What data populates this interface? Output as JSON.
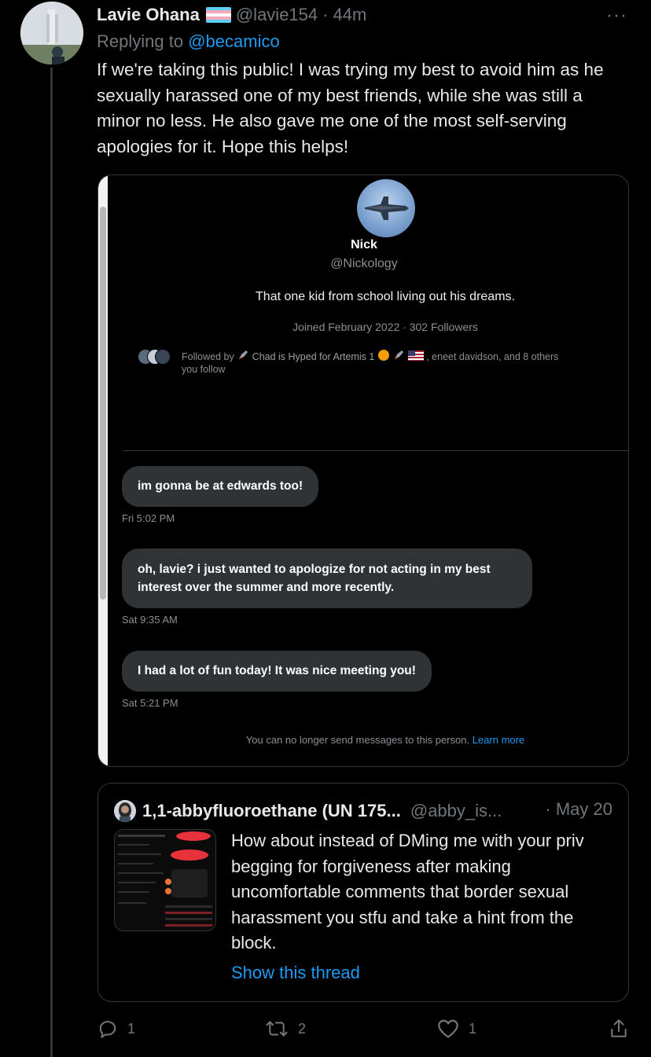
{
  "tweet": {
    "author_name": "Lavie Ohana",
    "author_handle": "@lavie154",
    "separator": "·",
    "time": "44m",
    "more_label": "···",
    "replying_prefix": "Replying to",
    "replying_handle": "@becamico",
    "text": "If we're taking this public! I was trying my best to avoid him as he sexually harassed one of my best friends, while she was still a minor no less. He also gave me one of the most self-serving apologies for it. Hope this helps!"
  },
  "dm_screenshot": {
    "profile_name": "Nick",
    "profile_handle": "@Nickology",
    "bio": "That one kid from school living out his dreams.",
    "joined": "Joined February 2022 · 302 Followers",
    "followed_by_prefix": "Followed by",
    "followed_by_name": "Chad is Hyped for Artemis 1",
    "followed_by_rest": ", eneet davidson, and 8 others",
    "followed_by_line2": "you follow",
    "messages": [
      {
        "text": "im gonna be at edwards too!",
        "time": "Fri 5:02 PM"
      },
      {
        "text": "oh, lavie? i just wanted to apologize for not acting in my best interest over the summer and more recently.",
        "time": "Sat 9:35 AM"
      },
      {
        "text": "I had a lot of fun today! It was nice meeting you!",
        "time": "Sat 5:21 PM"
      }
    ],
    "notice_text": "You can no longer send messages to this person.",
    "notice_link": "Learn more"
  },
  "quote": {
    "author_name": "1,1-abbyfluoroethane (UN 175...",
    "author_handle": "@abby_is...",
    "date": "· May 20",
    "text": "How about instead of DMing me with your priv begging for forgiveness after making uncomfortable comments that border sexual harassment you stfu and take a hint from the block.",
    "thread_link": "Show this thread"
  },
  "actions": {
    "replies": "1",
    "retweets": "2",
    "likes": "1"
  },
  "icons": {
    "reply": "reply-icon",
    "retweet": "retweet-icon",
    "like": "heart-icon",
    "share": "share-icon",
    "more": "more-icon",
    "trans_flag": "trans-flag-icon"
  },
  "colors": {
    "link": "#1d9bf0",
    "muted": "#71767b",
    "text": "#e7e9ea",
    "bubble": "#2f3336"
  }
}
